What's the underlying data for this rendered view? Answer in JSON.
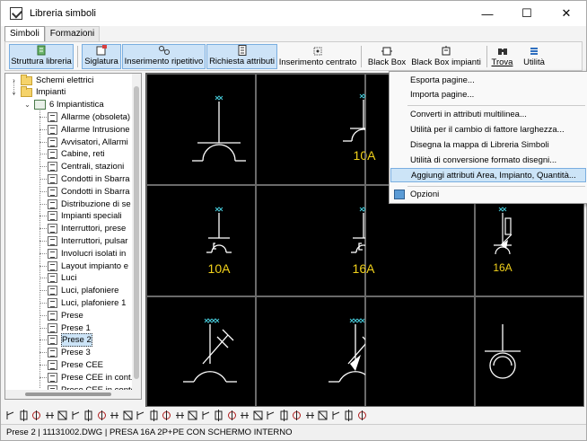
{
  "window": {
    "title": "Libreria simboli",
    "controls": {
      "minimize": "—",
      "maximize": "☐",
      "close": "✕"
    }
  },
  "tabs": [
    "Simboli",
    "Formazioni"
  ],
  "toolbar": {
    "struttura": "Struttura libreria",
    "siglatura": "Siglatura",
    "inserimento_ripetitivo": "Inserimento ripetitivo",
    "richiesta_attributi": "Richiesta attributi",
    "inserimento_centrato": "Inserimento centrato",
    "black_box": "Black Box",
    "black_box_impianti": "Black Box impianti",
    "trova": "Trova",
    "utilita": "Utilità"
  },
  "tree": {
    "schemi": "Schemi elettrici",
    "impianti": "Impianti",
    "impiantistica": "6 Impiantistica",
    "items": [
      "Allarme (obsoleta)",
      "Allarme Intrusione",
      "Avvisatori, Allarmi",
      "Cabine, reti",
      "Centrali, stazioni",
      "Condotti in Sbarra",
      "Condotti in Sbarra",
      "Distribuzione di se",
      "Impianti speciali",
      "Interruttori, prese",
      "Interruttori, pulsar",
      "Involucri isolati in",
      "Layout impianto e",
      "Luci",
      "Luci, plafoniere",
      "Luci, plafoniere 1",
      "Prese",
      "Prese 1",
      "Prese 2",
      "Prese 3",
      "Prese CEE",
      "Prese CEE in cont.",
      "Prese CEE in conte"
    ],
    "selected_item": "Prese 2"
  },
  "symbols": {
    "labels": [
      "10A",
      "10A",
      "16A",
      "16A"
    ]
  },
  "menu": {
    "items": [
      "Esporta pagine...",
      "Importa pagine...",
      "Converti in attributi multilinea...",
      "Utilità per il cambio di fattore larghezza...",
      "Disegna la mappa di Libreria Simboli",
      "Utilità di conversione formato disegni...",
      "Aggiungi attributi Area, Impianto, Quantità...",
      "Opzioni"
    ],
    "highlighted": "Aggiungi attributi Area, Impianto, Quantità...",
    "colors": {
      "highlight": "#cce4f7",
      "canvas": "#000000",
      "symbol_line": "#ffffff",
      "label": "#f2d21b",
      "pin": "#45c7d6"
    }
  },
  "status": {
    "text": "Prese 2 | 11131002.DWG | PRESA 16A 2P+PE CON SCHERMO INTERNO"
  }
}
